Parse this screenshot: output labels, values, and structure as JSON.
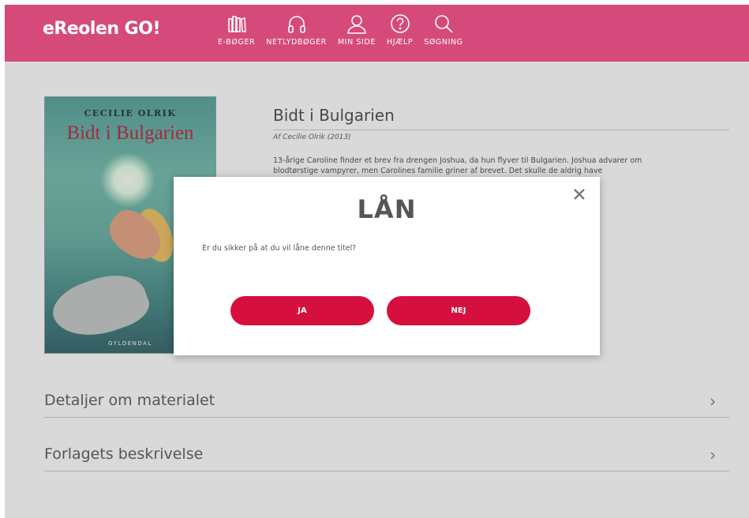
{
  "app": {
    "logo_text": "eReolen GO!"
  },
  "nav": [
    {
      "label": "E-BØGER",
      "icon": "books-icon"
    },
    {
      "label": "NETLYDBØGER",
      "icon": "headphones-icon"
    },
    {
      "label": "MIN SIDE",
      "icon": "user-icon"
    },
    {
      "label": "HJÆLP",
      "icon": "help-icon"
    },
    {
      "label": "SØGNING",
      "icon": "search-icon"
    }
  ],
  "book": {
    "cover_author": "CECILIE OLRIK",
    "cover_title": "Bidt i Bulgarien",
    "cover_publisher": "GYLDENDAL",
    "title": "Bidt i Bulgarien",
    "byline": "Af Cecilie Olrik (2013)",
    "description": "13-årige Caroline finder et brev fra drengen Joshua, da hun flyver til Bulgarien. Joshua advarer om blodtørstige vampyrer, men Carolines familie griner af brevet. Det skulle de aldrig have"
  },
  "sections": [
    {
      "label": "Detaljer om materialet"
    },
    {
      "label": "Forlagets beskrivelse"
    }
  ],
  "modal": {
    "title": "LÅN",
    "message": "Er du sikker på at du vil låne denne titel?",
    "yes_label": "JA",
    "no_label": "NEJ"
  },
  "colors": {
    "header_bg": "#d64a7b",
    "button_bg": "#d5103f"
  }
}
